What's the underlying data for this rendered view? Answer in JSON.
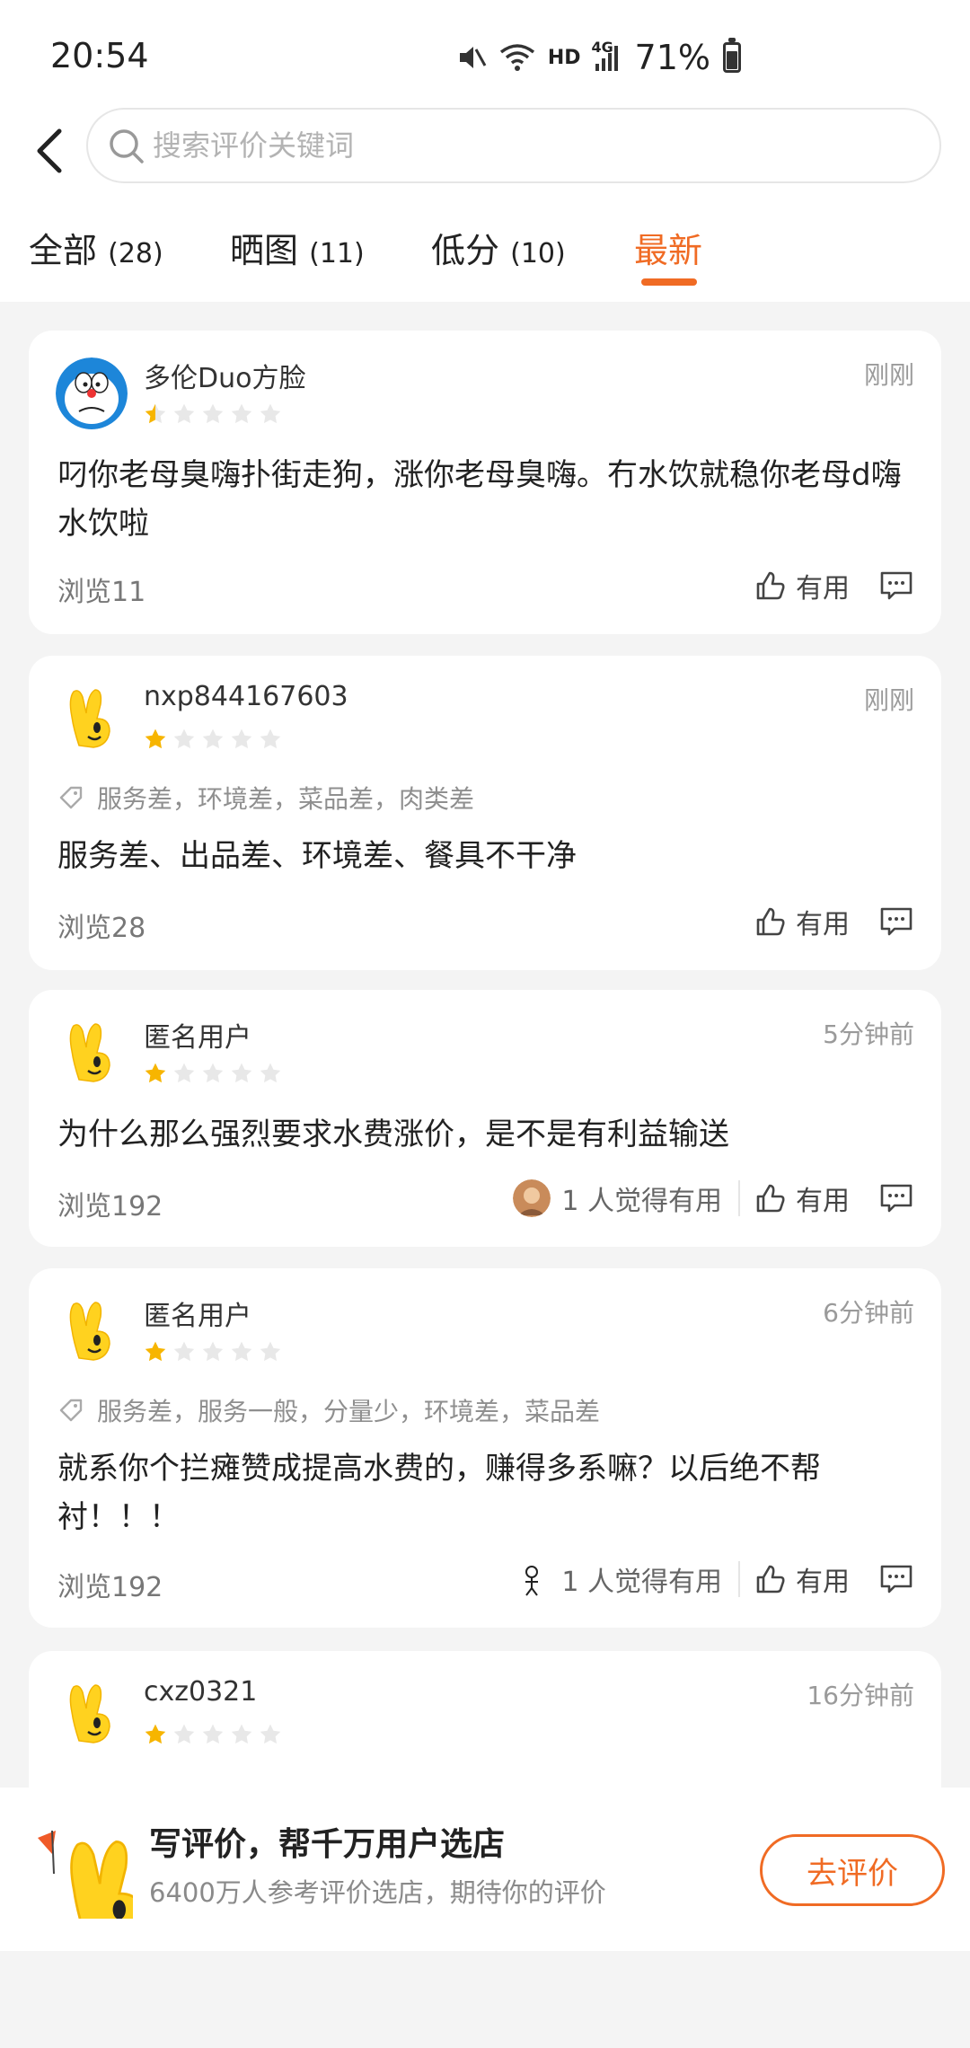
{
  "status_bar": {
    "time": "20:54",
    "network": "HD",
    "signal": "4G",
    "battery": "71%"
  },
  "search": {
    "placeholder": "搜索评价关键词"
  },
  "tabs": [
    {
      "label": "全部",
      "count": "(28)"
    },
    {
      "label": "晒图",
      "count": "(11)"
    },
    {
      "label": "低分",
      "count": "(10)"
    },
    {
      "label": "最新",
      "count": ""
    }
  ],
  "reviews": [
    {
      "user": "多伦Duo方脸",
      "time": "刚刚",
      "rating": 0.5,
      "tags": "",
      "text": "叼你老母臭嗨扑街走狗，涨你老母臭嗨。冇水饮就稳你老母d嗨水饮啦",
      "views": "浏览11",
      "liked": ""
    },
    {
      "user": "nxp844167603",
      "time": "刚刚",
      "rating": 1,
      "tags": "服务差，环境差，菜品差，肉类差",
      "text": "服务差、出品差、环境差、餐具不干净",
      "views": "浏览28",
      "liked": ""
    },
    {
      "user": "匿名用户",
      "time": "5分钟前",
      "rating": 1,
      "tags": "",
      "text": "为什么那么强烈要求水费涨价，是不是有利益输送",
      "views": "浏览192",
      "liked": "1 人觉得有用"
    },
    {
      "user": "匿名用户",
      "time": "6分钟前",
      "rating": 1,
      "tags": "服务差，服务一般，分量少，环境差，菜品差",
      "text": "就系你个拦瘫赞成提高水费的，赚得多系嘛？以后绝不帮衬！！！",
      "views": "浏览192",
      "liked": "1 人觉得有用"
    },
    {
      "user": "cxz0321",
      "time": "16分钟前",
      "rating": 1,
      "tags": "",
      "text": "",
      "views": "",
      "liked": ""
    }
  ],
  "actions": {
    "useful": "有用"
  },
  "banner": {
    "title": "写评价，帮千万用户选店",
    "subtitle": "6400万人参考评价选店，期待你的评价",
    "button": "去评价"
  },
  "colors": {
    "accent": "#f06b24",
    "star_filled": "#f7b500",
    "star_empty": "#e8e8e8"
  },
  "icons": [
    "back-arrow-icon",
    "search-icon",
    "tag-icon",
    "thumb-up-icon",
    "comment-icon",
    "star-icon"
  ]
}
